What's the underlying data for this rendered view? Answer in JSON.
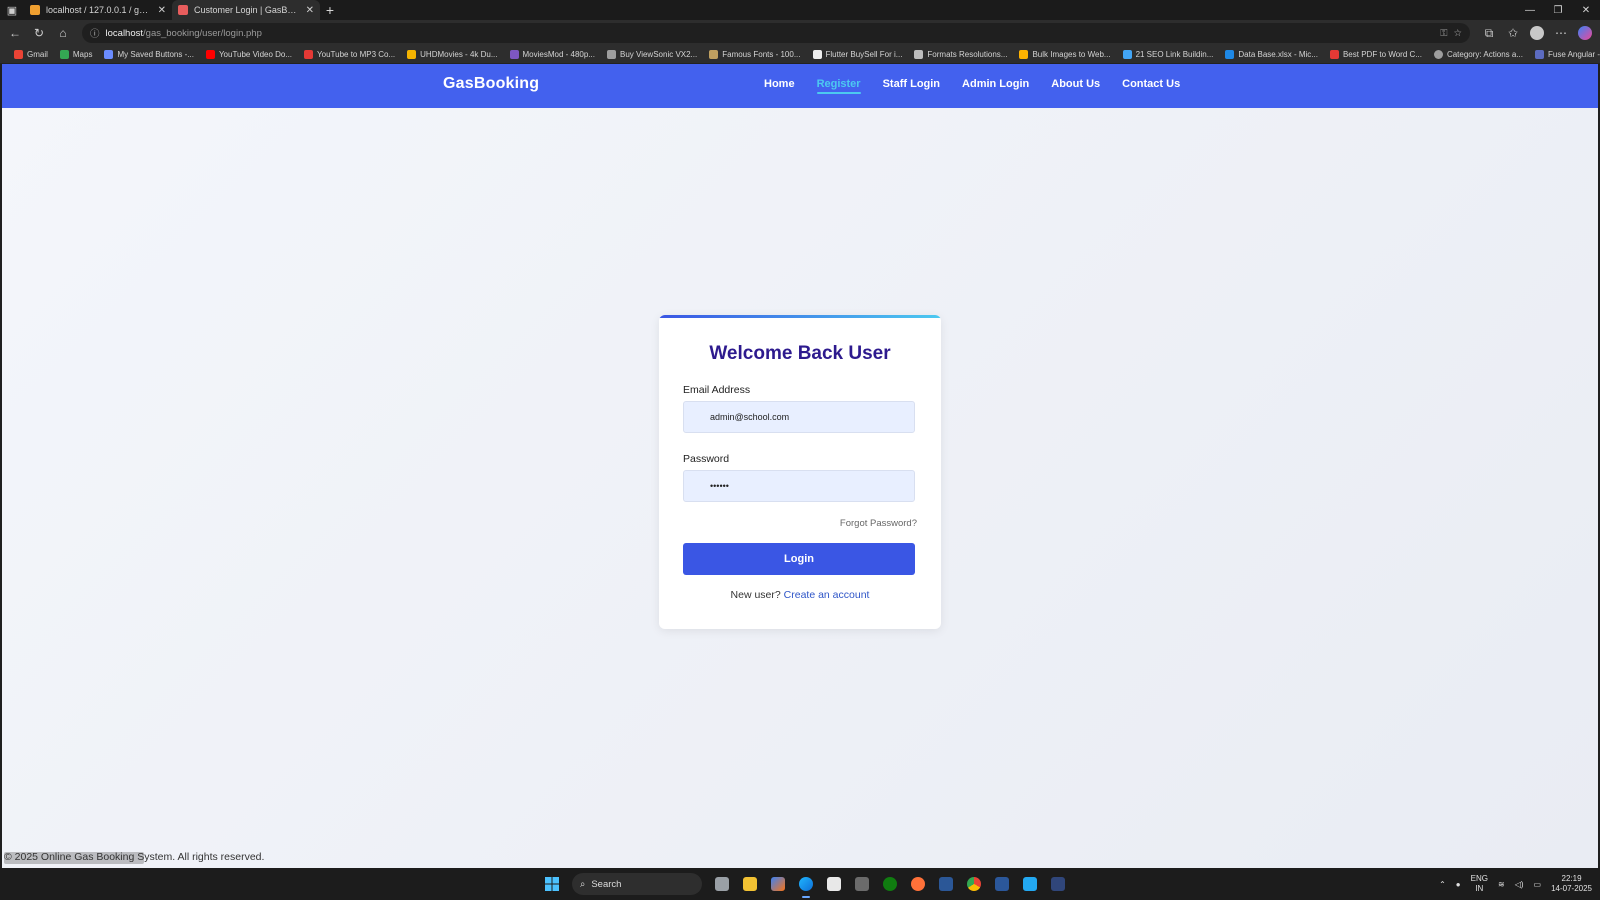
{
  "browser": {
    "tabs": [
      {
        "title": "localhost / 127.0.0.1 / gas_bookin",
        "favicon_color": "#f0a030",
        "active": false
      },
      {
        "title": "Customer Login | GasBooking",
        "favicon_color": "#e85d5d",
        "active": true
      }
    ],
    "address": {
      "host": "localhost",
      "path": "/gas_booking/user/login.php"
    },
    "bookmarks": [
      {
        "label": "Gmail",
        "color": "#ea4335"
      },
      {
        "label": "Maps",
        "color": "#34a853"
      },
      {
        "label": "My Saved Buttons -...",
        "color": "#6b8cff"
      },
      {
        "label": "YouTube Video Do...",
        "color": "#ff0000"
      },
      {
        "label": "YouTube to MP3 Co...",
        "color": "#e53935"
      },
      {
        "label": "UHDMovies - 4k Du...",
        "color": "#f5b400"
      },
      {
        "label": "MoviesMod - 480p...",
        "color": "#7e57c2"
      },
      {
        "label": "Buy ViewSonic VX2...",
        "color": "#9e9e9e"
      },
      {
        "label": "Famous Fonts - 100...",
        "color": "#c0a060"
      },
      {
        "label": "Flutter BuySell For i...",
        "color": "#eeeeee"
      },
      {
        "label": "Formats Resolutions...",
        "color": "#bdbdbd"
      },
      {
        "label": "Bulk Images to Web...",
        "color": "#ffb300"
      },
      {
        "label": "21 SEO Link Buildin...",
        "color": "#42a5f5"
      },
      {
        "label": "Data Base.xlsx - Mic...",
        "color": "#1e88e5"
      },
      {
        "label": "Best PDF to Word C...",
        "color": "#e53935"
      },
      {
        "label": "Category: Actions a...",
        "color": "#9e9e9e"
      },
      {
        "label": "Fuse Angular - Ang...",
        "color": "#5c6bc0"
      }
    ]
  },
  "site": {
    "brand": "GasBooking",
    "nav": [
      {
        "label": "Home",
        "active": false
      },
      {
        "label": "Register",
        "active": true
      },
      {
        "label": "Staff Login",
        "active": false
      },
      {
        "label": "Admin Login",
        "active": false
      },
      {
        "label": "About Us",
        "active": false
      },
      {
        "label": "Contact Us",
        "active": false
      }
    ],
    "accent_color": "#4361ee"
  },
  "login": {
    "title": "Welcome Back User",
    "email_label": "Email Address",
    "email_value": "admin@school.com",
    "password_label": "Password",
    "password_value": "••••••",
    "forgot_label": "Forgot Password?",
    "button_label": "Login",
    "signup_prompt": "New user?",
    "signup_link": "Create an account"
  },
  "footer": {
    "text": "© 2025 Online Gas Booking System. All rights reserved."
  },
  "taskbar": {
    "search_placeholder": "Search",
    "language": "ENG",
    "region": "IN",
    "time": "22:19",
    "date": "14-07-2025"
  }
}
